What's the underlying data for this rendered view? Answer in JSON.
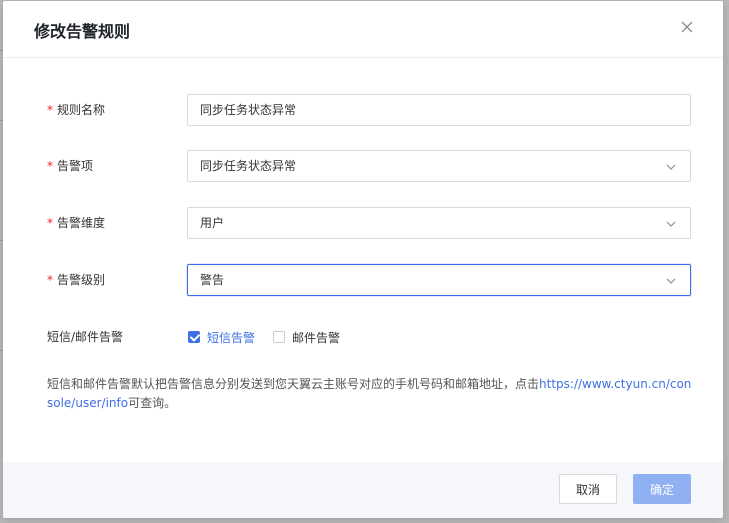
{
  "dialog": {
    "title": "修改告警规则",
    "close_icon": "close-icon"
  },
  "form": {
    "rule_name": {
      "label": "规则名称",
      "required": true,
      "value": "同步任务状态异常"
    },
    "alarm_item": {
      "label": "告警项",
      "required": true,
      "value": "同步任务状态异常"
    },
    "alarm_dimension": {
      "label": "告警维度",
      "required": true,
      "value": "用户"
    },
    "alarm_level": {
      "label": "告警级别",
      "required": true,
      "value": "警告"
    },
    "notify": {
      "label": "短信/邮件告警",
      "options": [
        {
          "label": "短信告警",
          "checked": true
        },
        {
          "label": "邮件告警",
          "checked": false
        }
      ]
    }
  },
  "hint": {
    "prefix": "短信和邮件告警默认把告警信息分别发送到您天翼云主账号对应的手机号码和邮箱地址，点击",
    "link": "https://www.ctyun.cn/console/user/info",
    "suffix": "可查询。"
  },
  "footer": {
    "cancel_label": "取消",
    "ok_label": "确定"
  },
  "colors": {
    "accent": "#3f6fe4",
    "required": "#f5222d",
    "ok_button": "#8fb0f3"
  }
}
